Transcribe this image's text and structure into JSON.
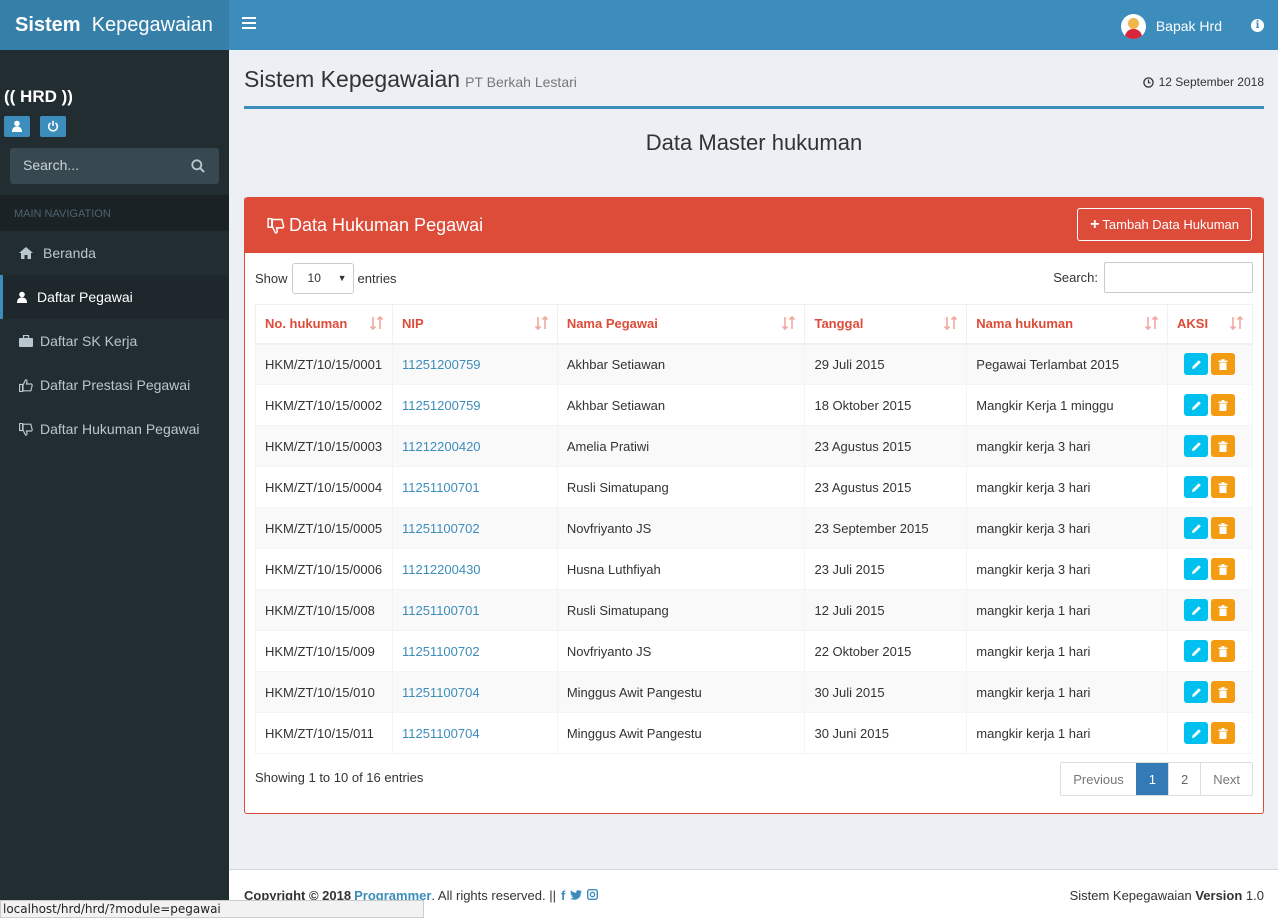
{
  "app": {
    "logo_bold": "Sistem",
    "logo_rest": "Kepegawaian",
    "user_name": "Bapak Hrd"
  },
  "sidebar": {
    "role": "(( HRD ))",
    "search_placeholder": "Search...",
    "nav_header": "MAIN NAVIGATION",
    "items": [
      {
        "label": "Beranda",
        "icon": "home-icon"
      },
      {
        "label": "Daftar Pegawai",
        "icon": "user-icon",
        "active": true
      },
      {
        "label": "Daftar SK Kerja",
        "icon": "briefcase-icon"
      },
      {
        "label": "Daftar Prestasi Pegawai",
        "icon": "thumbs-up-icon"
      },
      {
        "label": "Daftar Hukuman Pegawai",
        "icon": "thumbs-down-icon"
      }
    ]
  },
  "page": {
    "title": "Sistem Kepegawaian",
    "subtitle": "PT Berkah Lestari",
    "date": "12 September 2018",
    "section_title": "Data Master hukuman"
  },
  "box": {
    "title": "Data Hukuman Pegawai",
    "add_button": "Tambah Data Hukuman",
    "show_label": "Show",
    "entries_label": "entries",
    "page_length": "10",
    "search_label": "Search:",
    "columns": [
      "No. hukuman",
      "NIP",
      "Nama Pegawai",
      "Tanggal",
      "Nama hukuman",
      "AKSI"
    ],
    "rows": [
      [
        "HKM/ZT/10/15/0001",
        "11251200759",
        "Akhbar Setiawan",
        "29 Juli 2015",
        "Pegawai Terlambat 2015"
      ],
      [
        "HKM/ZT/10/15/0002",
        "11251200759",
        "Akhbar Setiawan",
        "18 Oktober 2015",
        "Mangkir Kerja 1 minggu"
      ],
      [
        "HKM/ZT/10/15/0003",
        "11212200420",
        "Amelia Pratiwi",
        "23 Agustus 2015",
        "mangkir kerja 3 hari"
      ],
      [
        "HKM/ZT/10/15/0004",
        "11251100701",
        "Rusli Simatupang",
        "23 Agustus 2015",
        "mangkir kerja 3 hari"
      ],
      [
        "HKM/ZT/10/15/0005",
        "11251100702",
        "Novfriyanto JS",
        "23 September 2015",
        "mangkir kerja 3 hari"
      ],
      [
        "HKM/ZT/10/15/0006",
        "11212200430",
        "Husna Luthfiyah",
        "23 Juli 2015",
        "mangkir kerja 3 hari"
      ],
      [
        "HKM/ZT/10/15/008",
        "11251100701",
        "Rusli Simatupang",
        "12 Juli 2015",
        "mangkir kerja 1 hari"
      ],
      [
        "HKM/ZT/10/15/009",
        "11251100702",
        "Novfriyanto JS",
        "22 Oktober 2015",
        "mangkir kerja 1 hari"
      ],
      [
        "HKM/ZT/10/15/010",
        "11251100704",
        "Minggus Awit Pangestu",
        "30 Juli 2015",
        "mangkir kerja 1 hari"
      ],
      [
        "HKM/ZT/10/15/011",
        "11251100704",
        "Minggus Awit Pangestu",
        "30 Juni 2015",
        "mangkir kerja 1 hari"
      ]
    ],
    "showing": "Showing 1 to 10 of 16 entries",
    "pagination": {
      "previous": "Previous",
      "pages": [
        "1",
        "2"
      ],
      "current": "1",
      "next": "Next"
    }
  },
  "footer": {
    "copyright": "Copyright © 2018",
    "author": "Programmer",
    "rights": ". All rights reserved. ||",
    "app_name": "Sistem Kepegawaian",
    "version_label": "Version",
    "version": "1.0"
  },
  "statusbar": {
    "url": "localhost/hrd/hrd/?module=pegawai"
  },
  "colors": {
    "header": "#3c8dbc",
    "logo": "#367fa9",
    "sidebar": "#222d32",
    "danger": "#dd4b39",
    "info": "#00c0ef",
    "warning": "#f39c12"
  }
}
